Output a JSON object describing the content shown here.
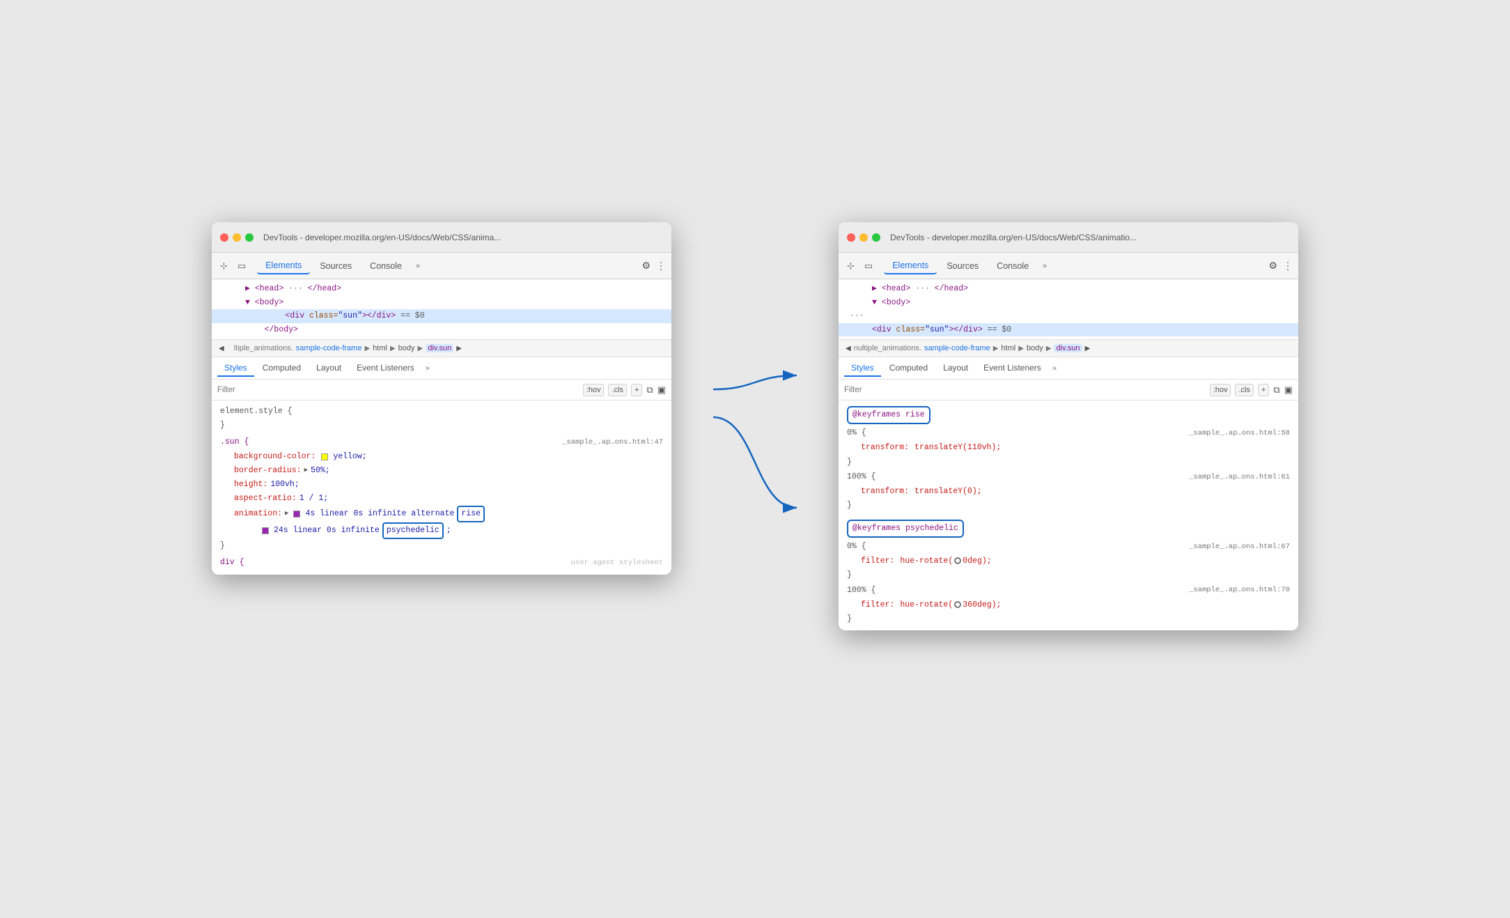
{
  "left_window": {
    "titlebar": {
      "url": "DevTools - developer.mozilla.org/en-US/docs/Web/CSS/anima..."
    },
    "toolbar": {
      "tabs": [
        "Elements",
        "Sources",
        "Console"
      ],
      "more": "»"
    },
    "html_tree": [
      {
        "indent": 2,
        "content": "▶ <head> ··· </head>",
        "selected": false
      },
      {
        "indent": 2,
        "content": "▼ <body>",
        "selected": false
      },
      {
        "indent": 4,
        "content": "<div class=\"sun\"></div>  == $0",
        "selected": true
      },
      {
        "indent": 4,
        "content": "</body>",
        "selected": false
      }
    ],
    "breadcrumb": {
      "dots": "···",
      "items": [
        "ltiple_animations.",
        "sample-code-frame",
        "html",
        "body",
        "div.sun"
      ],
      "arrow": "▶"
    },
    "styles_tabs": [
      "Styles",
      "Computed",
      "Layout",
      "Event Listeners",
      "»"
    ],
    "filter_placeholder": "Filter",
    "filter_actions": [
      ":hov",
      ".cls",
      "+"
    ],
    "css_blocks": [
      {
        "selector": "element.style {",
        "close": "}",
        "props": []
      },
      {
        "selector": ".sun {",
        "source": "_sample_.ap…ons.html:47",
        "close": "}",
        "props": [
          {
            "name": "background-color:",
            "value": "yellow",
            "swatch": "yellow"
          },
          {
            "name": "border-radius:",
            "value": "▶ 50%;"
          },
          {
            "name": "height:",
            "value": "100vh;"
          },
          {
            "name": "aspect-ratio:",
            "value": "1 / 1;"
          },
          {
            "name": "animation:",
            "value": "▶ 4s ■ linear 0s infinite alternate  rise",
            "highlight": "rise"
          },
          {
            "name": "",
            "value": "24s ■ linear 0s infinite  psychedelic;",
            "highlight": "psychedelic"
          }
        ]
      },
      {
        "selector": "div {",
        "source": "user agent stylesheet",
        "close": "}"
      }
    ]
  },
  "right_window": {
    "titlebar": {
      "url": "DevTools - developer.mozilla.org/en-US/docs/Web/CSS/animatio..."
    },
    "toolbar": {
      "tabs": [
        "Elements",
        "Sources",
        "Console"
      ],
      "more": "»"
    },
    "html_tree": [
      {
        "indent": 2,
        "content": "▶ <head> ··· </head>",
        "selected": false
      },
      {
        "indent": 2,
        "content": "▼ <body>",
        "selected": false
      },
      {
        "indent": 0,
        "content": "···",
        "selected": false
      },
      {
        "indent": 4,
        "content": "<div class=\"sun\"></div>  == $0",
        "selected": true
      }
    ],
    "breadcrumb": {
      "arrow_left": "◀",
      "items": [
        "nultiple_animations.",
        "sample-code-frame",
        "html",
        "body",
        "div.sun"
      ],
      "arrow_right": "▶"
    },
    "styles_tabs": [
      "Styles",
      "Computed",
      "Layout",
      "Event Listeners",
      "»"
    ],
    "filter_placeholder": "Filter",
    "filter_actions": [
      ":hov",
      ".cls",
      "+"
    ],
    "css_blocks": [
      {
        "id": "keyframes-rise",
        "label": "@keyframes rise",
        "props": [
          {
            "pct": "0% {",
            "source": "_sample_.ap…ons.html:58",
            "props": [
              {
                "name": "transform:",
                "value": "translateY(110vh);"
              }
            ],
            "close": "}"
          },
          {
            "pct": "100% {",
            "source": "_sample_.ap…ons.html:61",
            "props": [
              {
                "name": "transform:",
                "value": "translateY(0);"
              }
            ],
            "close": "}"
          }
        ]
      },
      {
        "id": "keyframes-psychedelic",
        "label": "@keyframes psychedelic",
        "props": [
          {
            "pct": "0% {",
            "source": "_sample_.ap…ons.html:67",
            "props": [
              {
                "name": "filter:",
                "value": "hue-rotate(",
                "circle": true,
                "val2": "0deg);"
              }
            ],
            "close": "}"
          },
          {
            "pct": "100% {",
            "source": "_sample_.ap…ons.html:70",
            "props": [
              {
                "name": "filter:",
                "value": "hue-rotate(",
                "circle": true,
                "val2": "360deg);"
              }
            ],
            "close": "}"
          }
        ]
      }
    ]
  },
  "arrows": {
    "rise_label": "rise",
    "psychedelic_label": "psychedelic"
  }
}
